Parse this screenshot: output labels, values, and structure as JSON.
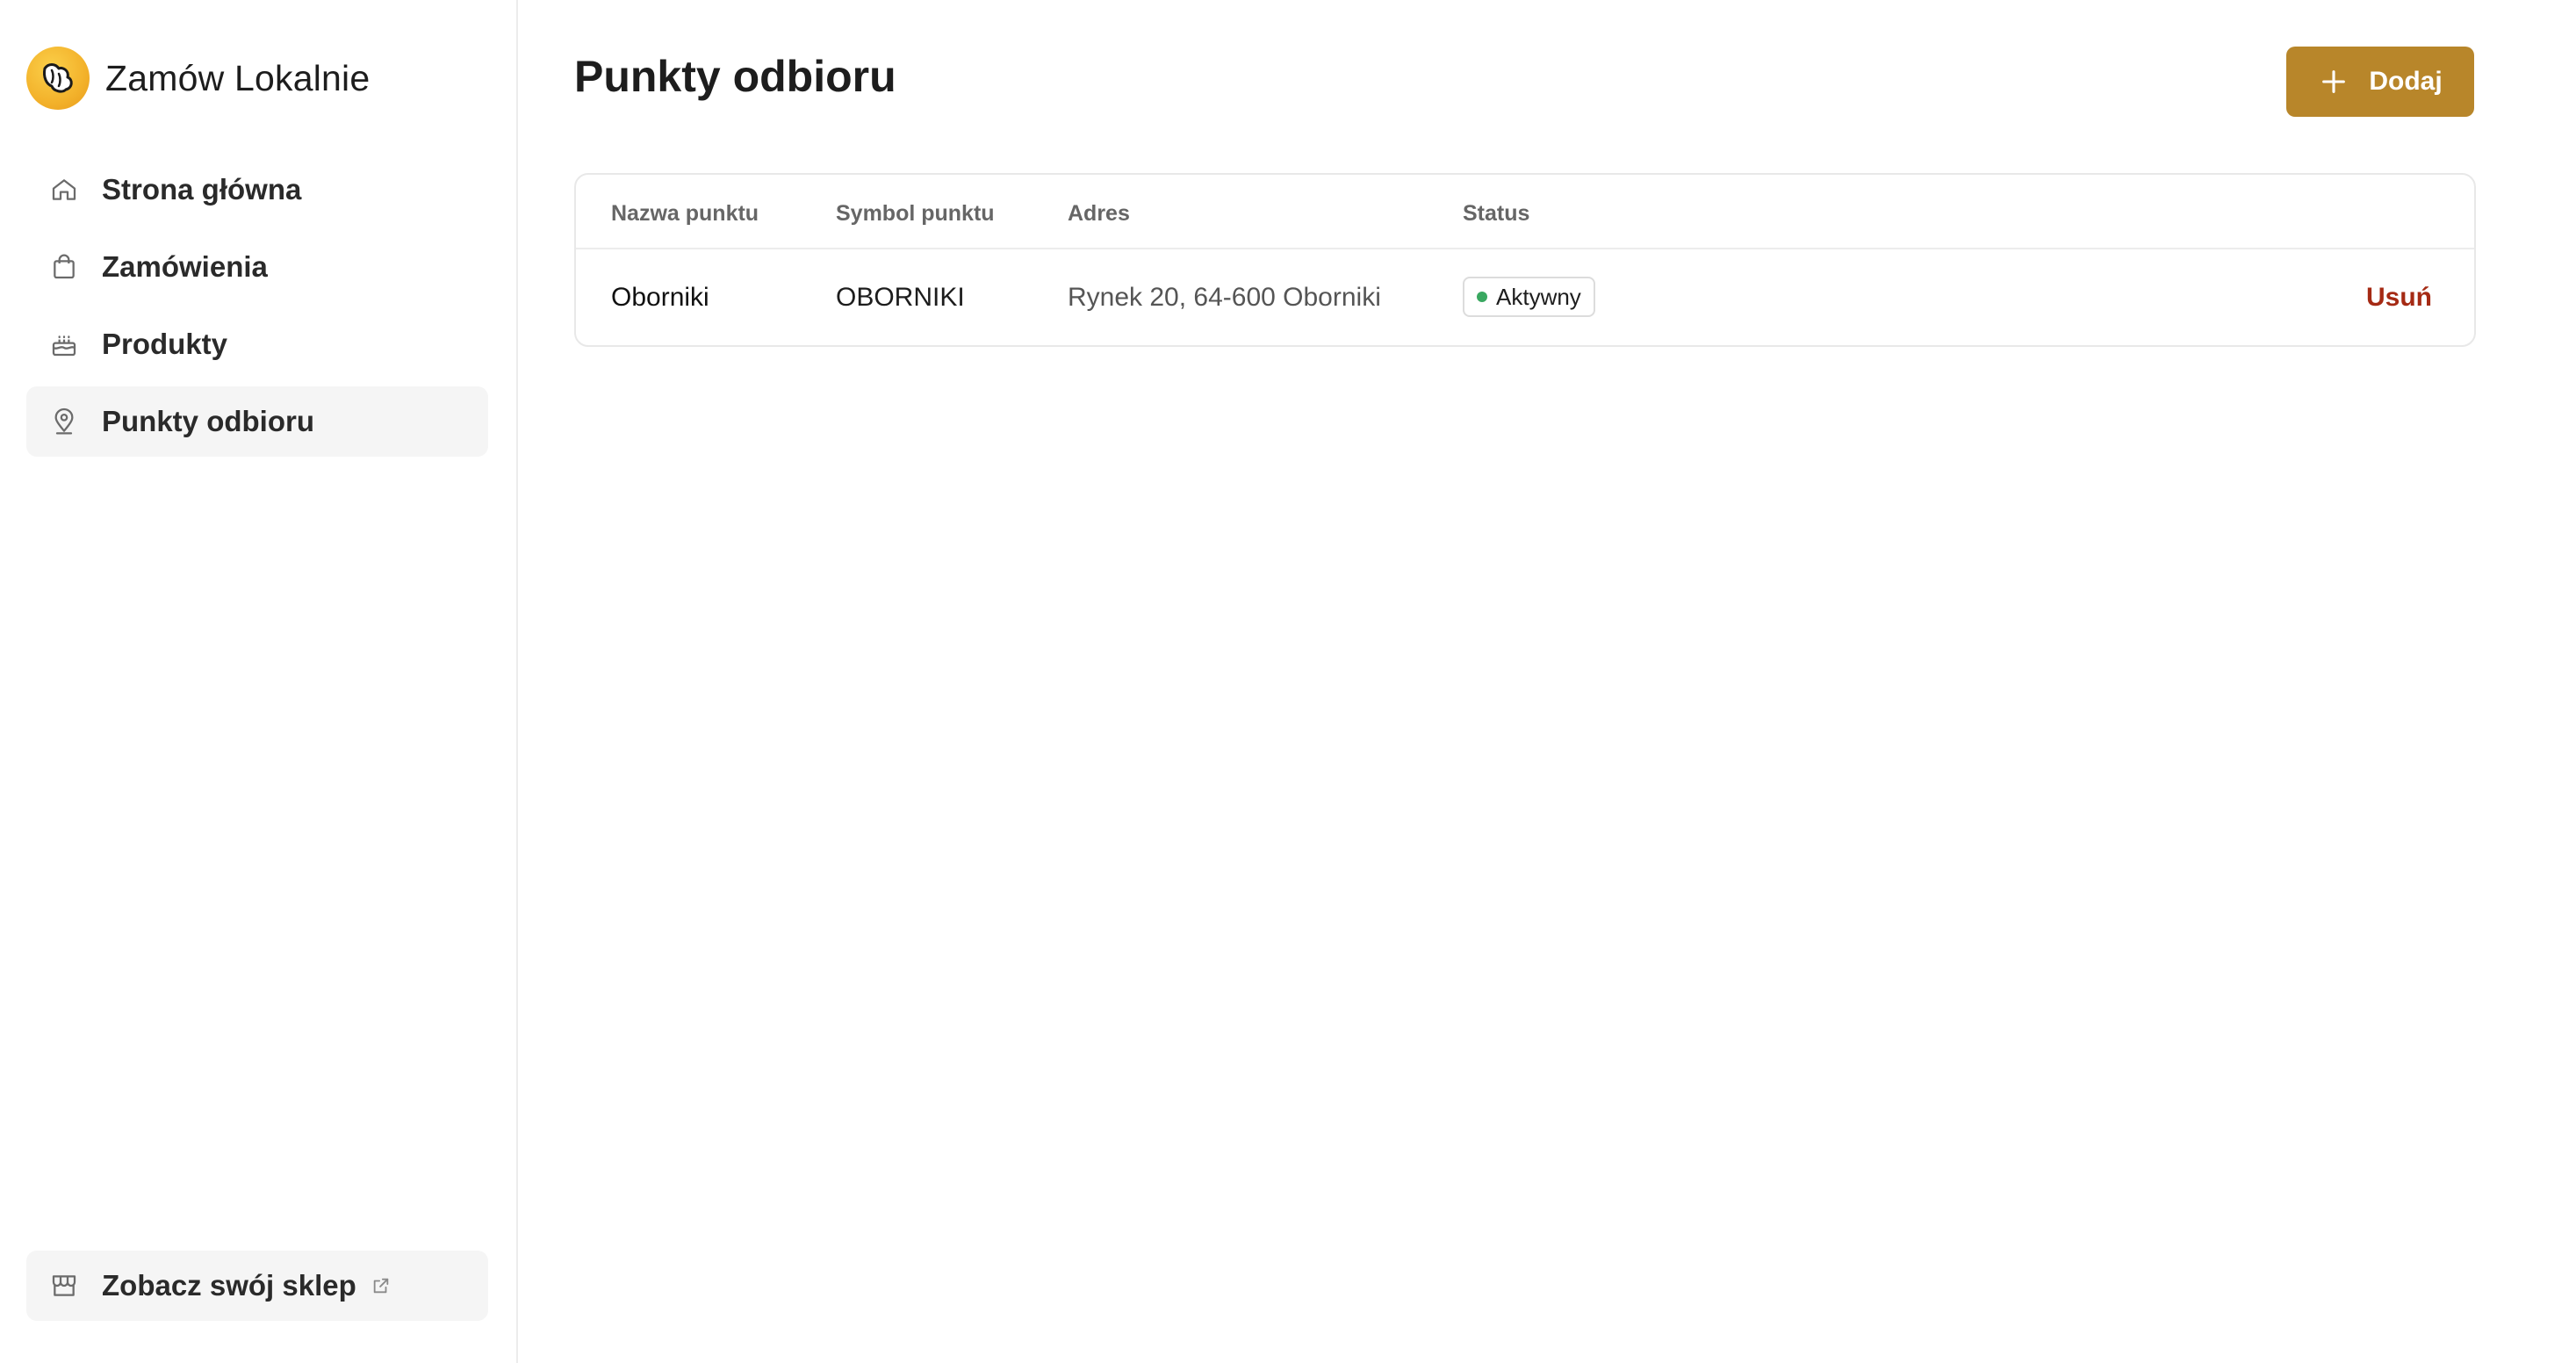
{
  "app": {
    "name": "Zamów Lokalnie",
    "logo_icon": "croissant-icon"
  },
  "sidebar": {
    "items": [
      {
        "label": "Strona główna",
        "icon": "home-icon",
        "active": false
      },
      {
        "label": "Zamówienia",
        "icon": "shopping-bag-icon",
        "active": false
      },
      {
        "label": "Produkty",
        "icon": "cake-icon",
        "active": false
      },
      {
        "label": "Punkty odbioru",
        "icon": "map-pin-icon",
        "active": true
      }
    ],
    "store_link": {
      "label": "Zobacz swój sklep",
      "icon": "store-icon",
      "trailing_icon": "external-link-icon"
    }
  },
  "main": {
    "title": "Punkty odbioru",
    "add_button": {
      "label": "Dodaj",
      "icon": "plus-icon"
    },
    "table": {
      "columns": [
        "Nazwa punktu",
        "Symbol punktu",
        "Adres",
        "Status"
      ],
      "rows": [
        {
          "name": "Oborniki",
          "symbol": "OBORNIKI",
          "address": "Rynek 20, 64-600 Oborniki",
          "status": "Aktywny",
          "action": "Usuń"
        }
      ]
    }
  },
  "colors": {
    "accent": "#b8862a",
    "status_active": "#39a860",
    "danger": "#a52a14"
  }
}
